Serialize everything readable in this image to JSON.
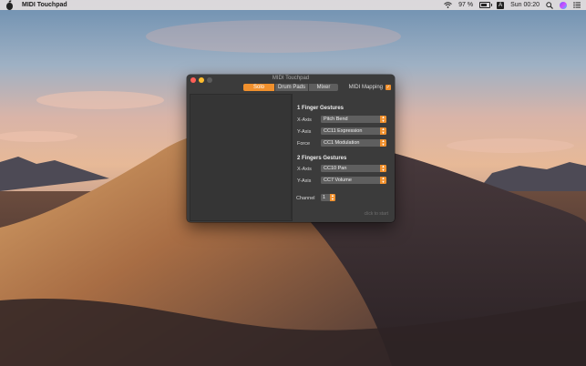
{
  "menubar": {
    "app_name": "MIDI Touchpad",
    "battery": "97 %",
    "input_source": "A",
    "clock": "Sun 00:20"
  },
  "window": {
    "title": "MIDI Touchpad",
    "tabs": [
      {
        "label": "Solo",
        "active": true
      },
      {
        "label": "Drum Pads",
        "active": false
      },
      {
        "label": "Mixer",
        "active": false
      }
    ],
    "midi_mapping": {
      "label": "MIDI Mapping",
      "checked": true
    }
  },
  "one_finger": {
    "heading": "1 Finger Gestures",
    "rows": [
      {
        "label": "X-Axis",
        "value": "Pitch Bend"
      },
      {
        "label": "Y-Axis",
        "value": "CC11 Expression"
      },
      {
        "label": "Force",
        "value": "CC1 Modulation"
      }
    ]
  },
  "two_fingers": {
    "heading": "2 Fingers Gestures",
    "rows": [
      {
        "label": "X-Axis",
        "value": "CC10 Pan"
      },
      {
        "label": "Y-Axis",
        "value": "CC7 Volume"
      }
    ]
  },
  "channel": {
    "label": "Channel",
    "value": "1"
  },
  "hint": "click to start",
  "colors": {
    "accent": "#f0902d",
    "window": "#3b3b3b"
  }
}
